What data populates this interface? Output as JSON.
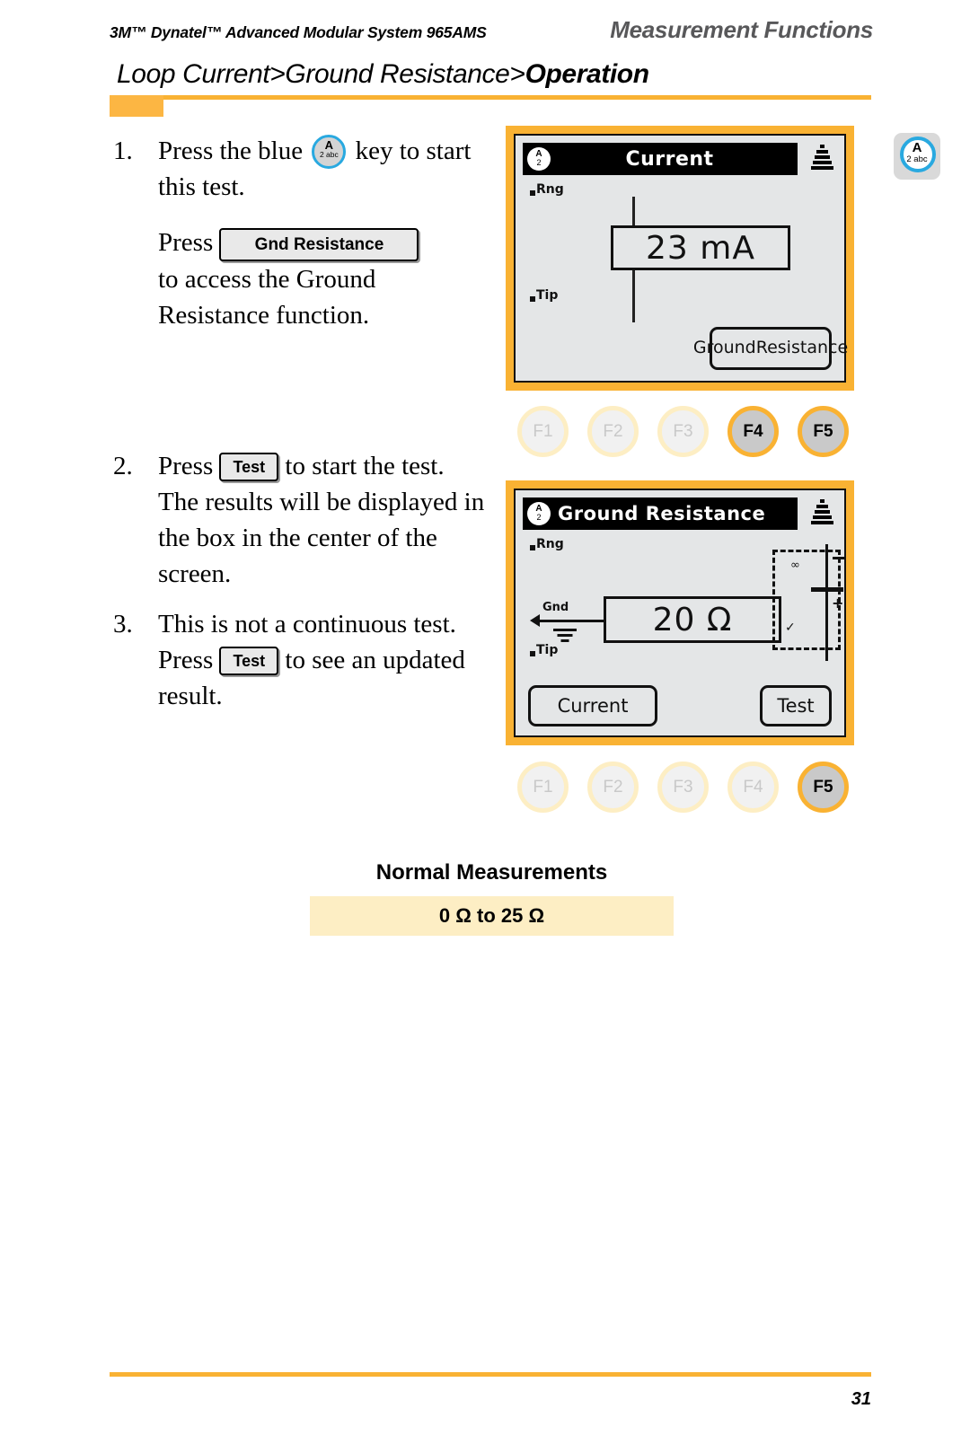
{
  "header": {
    "left": "3M™ Dynatel™ Advanced Modular System 965AMS",
    "right": "Measurement Functions"
  },
  "title": {
    "prefix": "Loop Current>Ground Resistance>",
    "bold": "Operation"
  },
  "steps": [
    {
      "num": "1.",
      "text_before_key": "Press the blue ",
      "text_after_key": " key to start this test.",
      "press_label": "Press",
      "button_label": "Gnd Resistance",
      "text_tail": "to access the Ground Resistance function."
    },
    {
      "num": "2.",
      "text_before_btn": "Press ",
      "button_label": "Test",
      "text_after_btn": " to start the test. The results will be displayed in the box in the center of the screen."
    },
    {
      "num": "3.",
      "text_before_btn": "This is not a continuous test. Press ",
      "button_label": "Test",
      "text_after_btn": " to see an updated result."
    }
  ],
  "key_glyph": {
    "letter": "A",
    "sub": "2 abc"
  },
  "margin_key": {
    "letter": "A",
    "sub": "2 abc"
  },
  "screens": [
    {
      "badge_letter": "A",
      "badge_sub": "2",
      "title": "Current",
      "ring_label": "Rng",
      "tip_label": "Tip",
      "value": "23 mA",
      "softkey_line1": "Ground",
      "softkey_line2": "Resistance"
    },
    {
      "badge_letter": "A",
      "badge_sub": "2",
      "title": "Ground Resistance",
      "ring_label": "Rng",
      "tip_label": "Tip",
      "gnd_label": "Gnd",
      "value": "20 Ω",
      "battery_infinity": "∞",
      "battery_minus": "−",
      "battery_plus": "+",
      "battery_check": "✓",
      "softkey_left": "Current",
      "softkey_right": "Test"
    }
  ],
  "fkeys": {
    "row1": [
      {
        "label": "F1",
        "active": false
      },
      {
        "label": "F2",
        "active": false
      },
      {
        "label": "F3",
        "active": false
      },
      {
        "label": "F4",
        "active": true
      },
      {
        "label": "F5",
        "active": true
      }
    ],
    "row2": [
      {
        "label": "F1",
        "active": false
      },
      {
        "label": "F2",
        "active": false
      },
      {
        "label": "F3",
        "active": false
      },
      {
        "label": "F4",
        "active": false
      },
      {
        "label": "F5",
        "active": true
      }
    ]
  },
  "normal_measurements": {
    "title": "Normal Measurements",
    "range": "0 Ω to 25 Ω"
  },
  "footer": {
    "page": "31"
  },
  "colors": {
    "accent_orange": "#f9b233",
    "key_blue": "#29a9e0",
    "cream": "#fdeec4",
    "lcd_bg": "#e4e6e7"
  }
}
